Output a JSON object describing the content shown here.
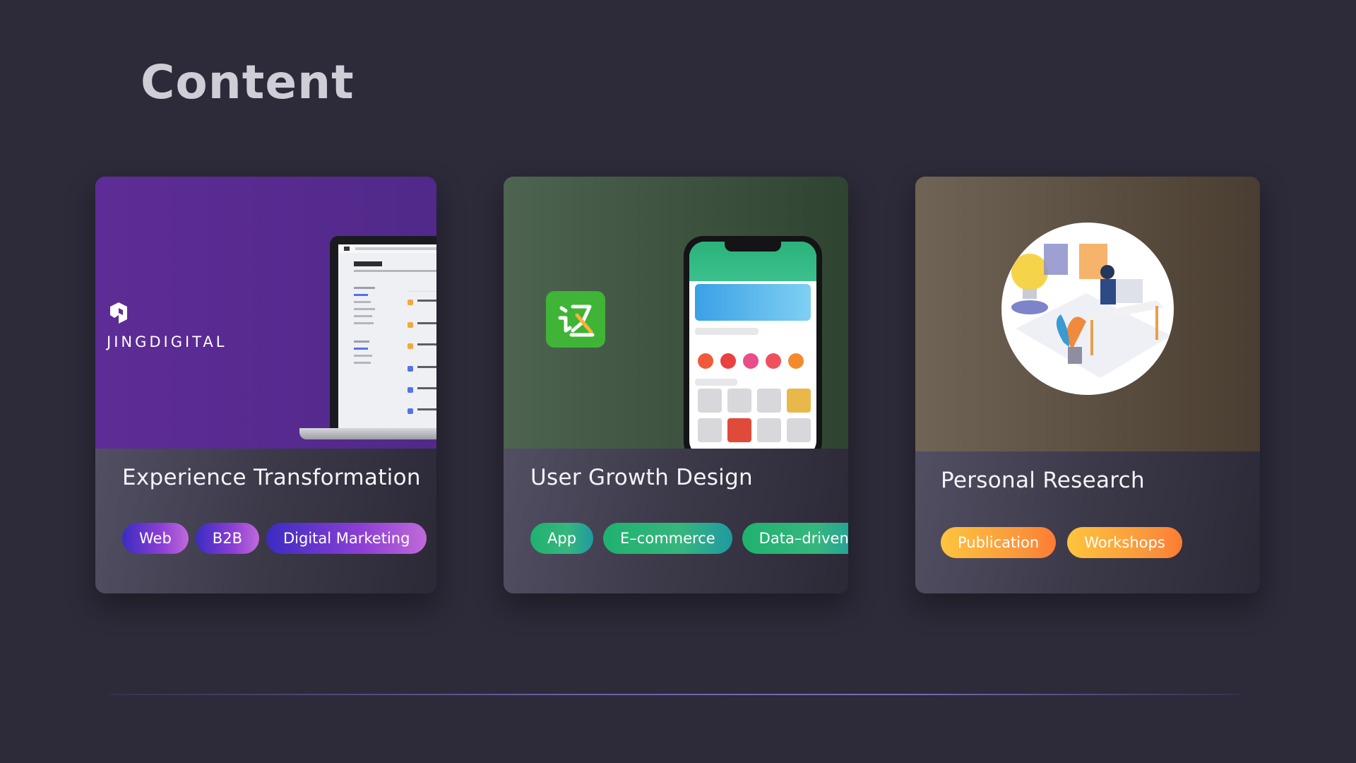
{
  "page": {
    "title": "Content"
  },
  "cards": [
    {
      "title": "Experience Transformation",
      "logo_text": "JINGDIGITAL",
      "tags": [
        "Web",
        "B2B",
        "Digital Marketing"
      ]
    },
    {
      "title": "User Growth Design",
      "tags": [
        "App",
        "E–commerce",
        "Data–driven"
      ]
    },
    {
      "title": "Personal Research",
      "tags": [
        "Publication",
        "Workshops"
      ]
    }
  ],
  "colors": {
    "background": "#2d2a39",
    "purple_tag": "#6a37cf",
    "green_tag": "#32b47c",
    "orange_tag": "#fcae3b"
  }
}
